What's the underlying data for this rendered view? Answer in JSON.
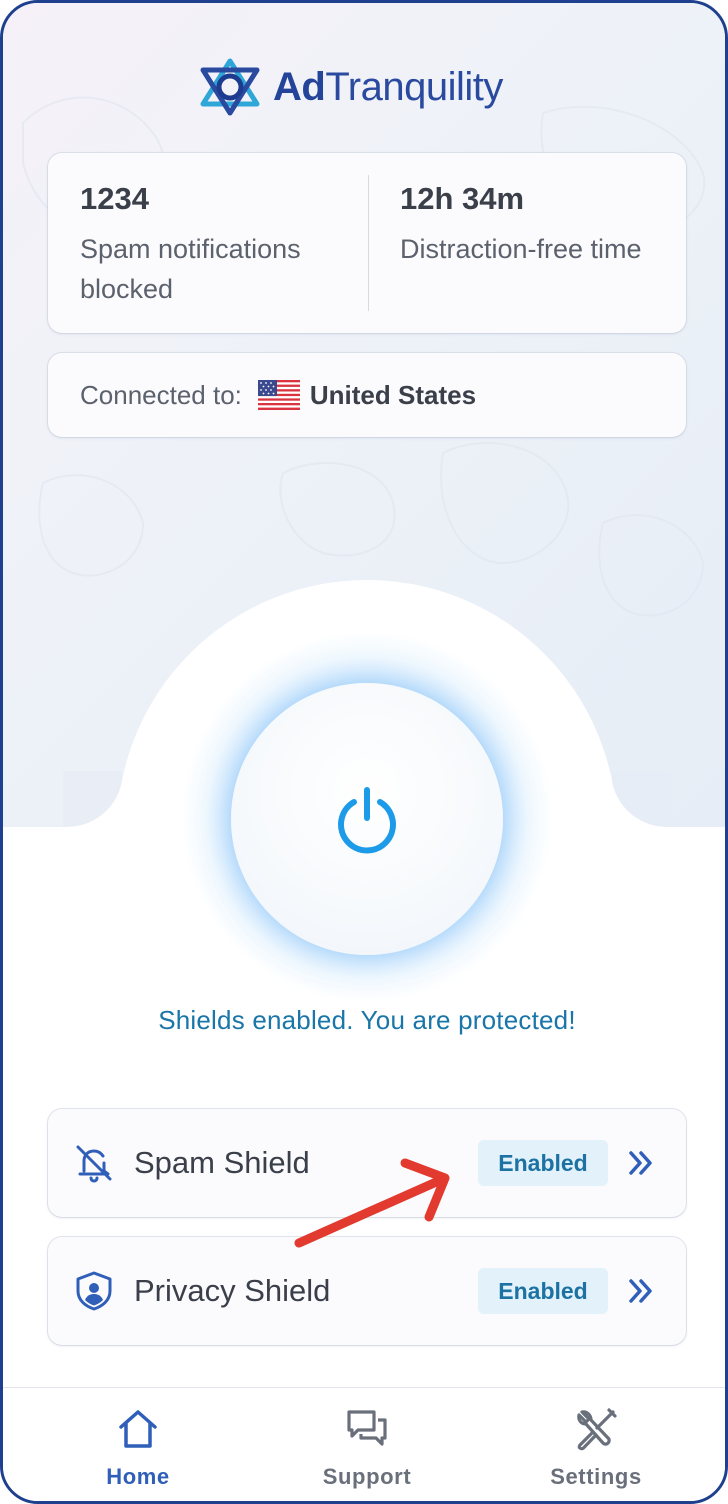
{
  "app": {
    "name_bold": "Ad",
    "name_rest": "Tranquility",
    "accent_color": "#2a4aa0",
    "logo_icon": "star-of-david-logo-icon"
  },
  "stats": {
    "left": {
      "value": "1234",
      "label": "Spam notifications blocked"
    },
    "right": {
      "value": "12h 34m",
      "label": "Distraction-free time"
    }
  },
  "connection": {
    "label": "Connected to:",
    "country": "United States",
    "flag_icon": "us-flag-icon"
  },
  "power": {
    "icon": "power-icon",
    "state_color": "#1e9be8"
  },
  "status_text": "Shields enabled. You are protected!",
  "shields": [
    {
      "name": "Spam Shield",
      "icon": "bell-off-icon",
      "badge": "Enabled"
    },
    {
      "name": "Privacy Shield",
      "icon": "shield-user-icon",
      "badge": "Enabled"
    }
  ],
  "annotation": {
    "icon": "red-arrow-icon",
    "color": "#e23a2e"
  },
  "nav": {
    "items": [
      {
        "label": "Home",
        "icon": "home-icon",
        "active": true
      },
      {
        "label": "Support",
        "icon": "chat-icon",
        "active": false
      },
      {
        "label": "Settings",
        "icon": "tools-icon",
        "active": false
      }
    ]
  }
}
